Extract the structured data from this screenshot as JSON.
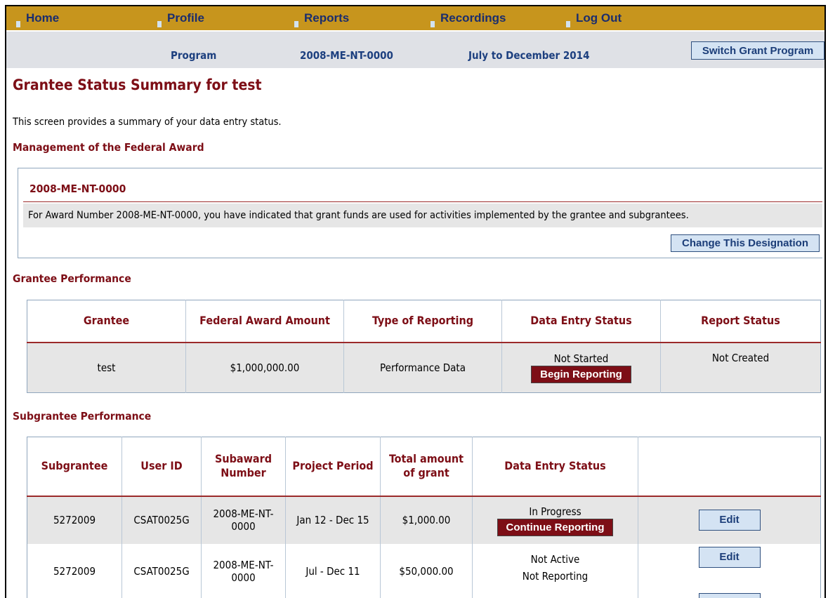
{
  "nav": {
    "items": [
      {
        "label": "Home"
      },
      {
        "label": "Profile"
      },
      {
        "label": "Reports"
      },
      {
        "label": "Recordings"
      },
      {
        "label": "Log Out"
      }
    ]
  },
  "subbar": {
    "program_label": "Program",
    "award_number": "2008-ME-NT-0000",
    "period": "July to December 2014",
    "switch_button": "Switch Grant Program"
  },
  "page": {
    "title": "Grantee Status Summary for test",
    "intro": "This screen provides a summary of your data entry status."
  },
  "management": {
    "heading": "Management of the Federal Award",
    "award_id": "2008-ME-NT-0000",
    "text": "For Award Number 2008-ME-NT-0000, you have indicated that grant funds are used for activities implemented by the grantee and subgrantees.",
    "change_button": "Change This Designation"
  },
  "grantee_performance": {
    "heading": "Grantee Performance",
    "columns": [
      "Grantee",
      "Federal Award Amount",
      "Type of Reporting",
      "Data Entry Status",
      "Report Status"
    ],
    "row": {
      "grantee": "test",
      "amount": "$1,000,000.00",
      "type": "Performance Data",
      "status": "Not Started",
      "action": "Begin Reporting",
      "report_status": "Not Created"
    }
  },
  "subgrantee_performance": {
    "heading": "Subgrantee Performance",
    "columns": [
      "Subgrantee",
      "User ID",
      "Subaward Number",
      "Project Period",
      "Total amount of grant",
      "Data Entry Status",
      ""
    ],
    "rows": [
      {
        "subgrantee": "5272009",
        "user_id": "CSAT0025G",
        "subaward": "2008-ME-NT-0000",
        "period": "Jan 12 - Dec 15",
        "amount": "$1,000.00",
        "status": "In Progress",
        "action": "Continue Reporting",
        "edit": "Edit"
      },
      {
        "subgrantee": "5272009",
        "user_id": "CSAT0025G",
        "subaward": "2008-ME-NT-0000",
        "period": "Jul - Dec 11",
        "amount": "$50,000.00",
        "status": "Not Active",
        "status2": "Not Reporting",
        "edit": "Edit"
      }
    ]
  },
  "colors": {
    "nav_bg": "#c7951d",
    "subbar_bg": "#dfe1e6",
    "maroon": "#7d0e16",
    "nav_text": "#1a2d6e",
    "button_blue": "#d4e3f3"
  }
}
